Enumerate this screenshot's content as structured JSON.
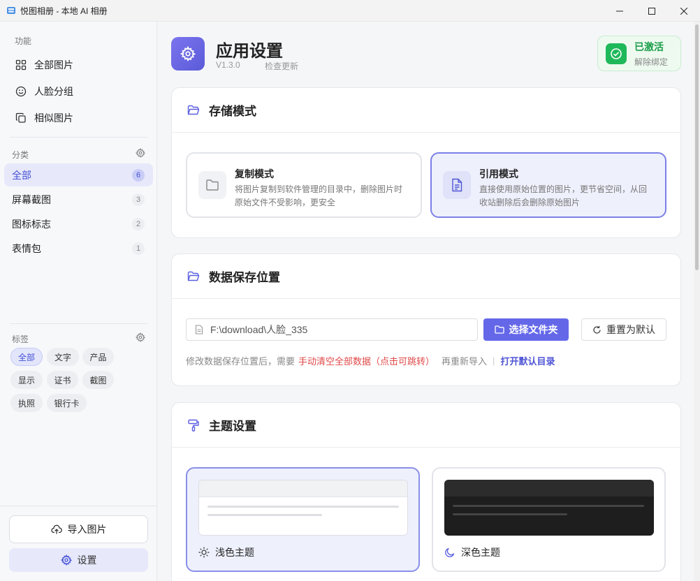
{
  "window": {
    "title": "悦图相册 - 本地 AI 相册"
  },
  "sidebar": {
    "functions_label": "功能",
    "functions": [
      {
        "label": "全部图片",
        "icon": "grid-icon"
      },
      {
        "label": "人脸分组",
        "icon": "smile-icon"
      },
      {
        "label": "相似图片",
        "icon": "copy-icon"
      }
    ],
    "categories_label": "分类",
    "categories": [
      {
        "label": "全部",
        "count": "6",
        "active": true
      },
      {
        "label": "屏幕截图",
        "count": "3"
      },
      {
        "label": "图标标志",
        "count": "2"
      },
      {
        "label": "表情包",
        "count": "1"
      }
    ],
    "tags_label": "标签",
    "tags": [
      "全部",
      "文字",
      "产品",
      "显示",
      "证书",
      "截图",
      "执照",
      "银行卡"
    ],
    "import_label": "导入图片",
    "settings_label": "设置"
  },
  "header": {
    "title": "应用设置",
    "version": "V1.3.0",
    "check_update": "检查更新",
    "activation": {
      "title": "已激活",
      "sub": "解除绑定"
    }
  },
  "storage": {
    "title": "存储模式",
    "modes": [
      {
        "title": "复制模式",
        "desc": "将图片复制到软件管理的目录中，删除图片时原始文件不受影响，更安全"
      },
      {
        "title": "引用模式",
        "desc": "直接使用原始位置的图片，更节省空间，从回收站删除后会删除原始图片"
      }
    ]
  },
  "data_location": {
    "title": "数据保存位置",
    "path": "F:\\download\\人脸_335",
    "choose_label": "选择文件夹",
    "reset_label": "重置为默认",
    "hint_prefix": "修改数据保存位置后，需要",
    "hint_danger": "手动清空全部数据（点击可跳转）",
    "hint_suffix": "再重新导入",
    "hint_sep": "|",
    "open_default": "打开默认目录"
  },
  "theme": {
    "title": "主题设置",
    "light_label": "浅色主题",
    "dark_label": "深色主题"
  },
  "colors": {
    "accent": "#6468e8",
    "active_bg": "#e7e9fb",
    "success": "#1fb85a",
    "danger": "#e04848"
  }
}
